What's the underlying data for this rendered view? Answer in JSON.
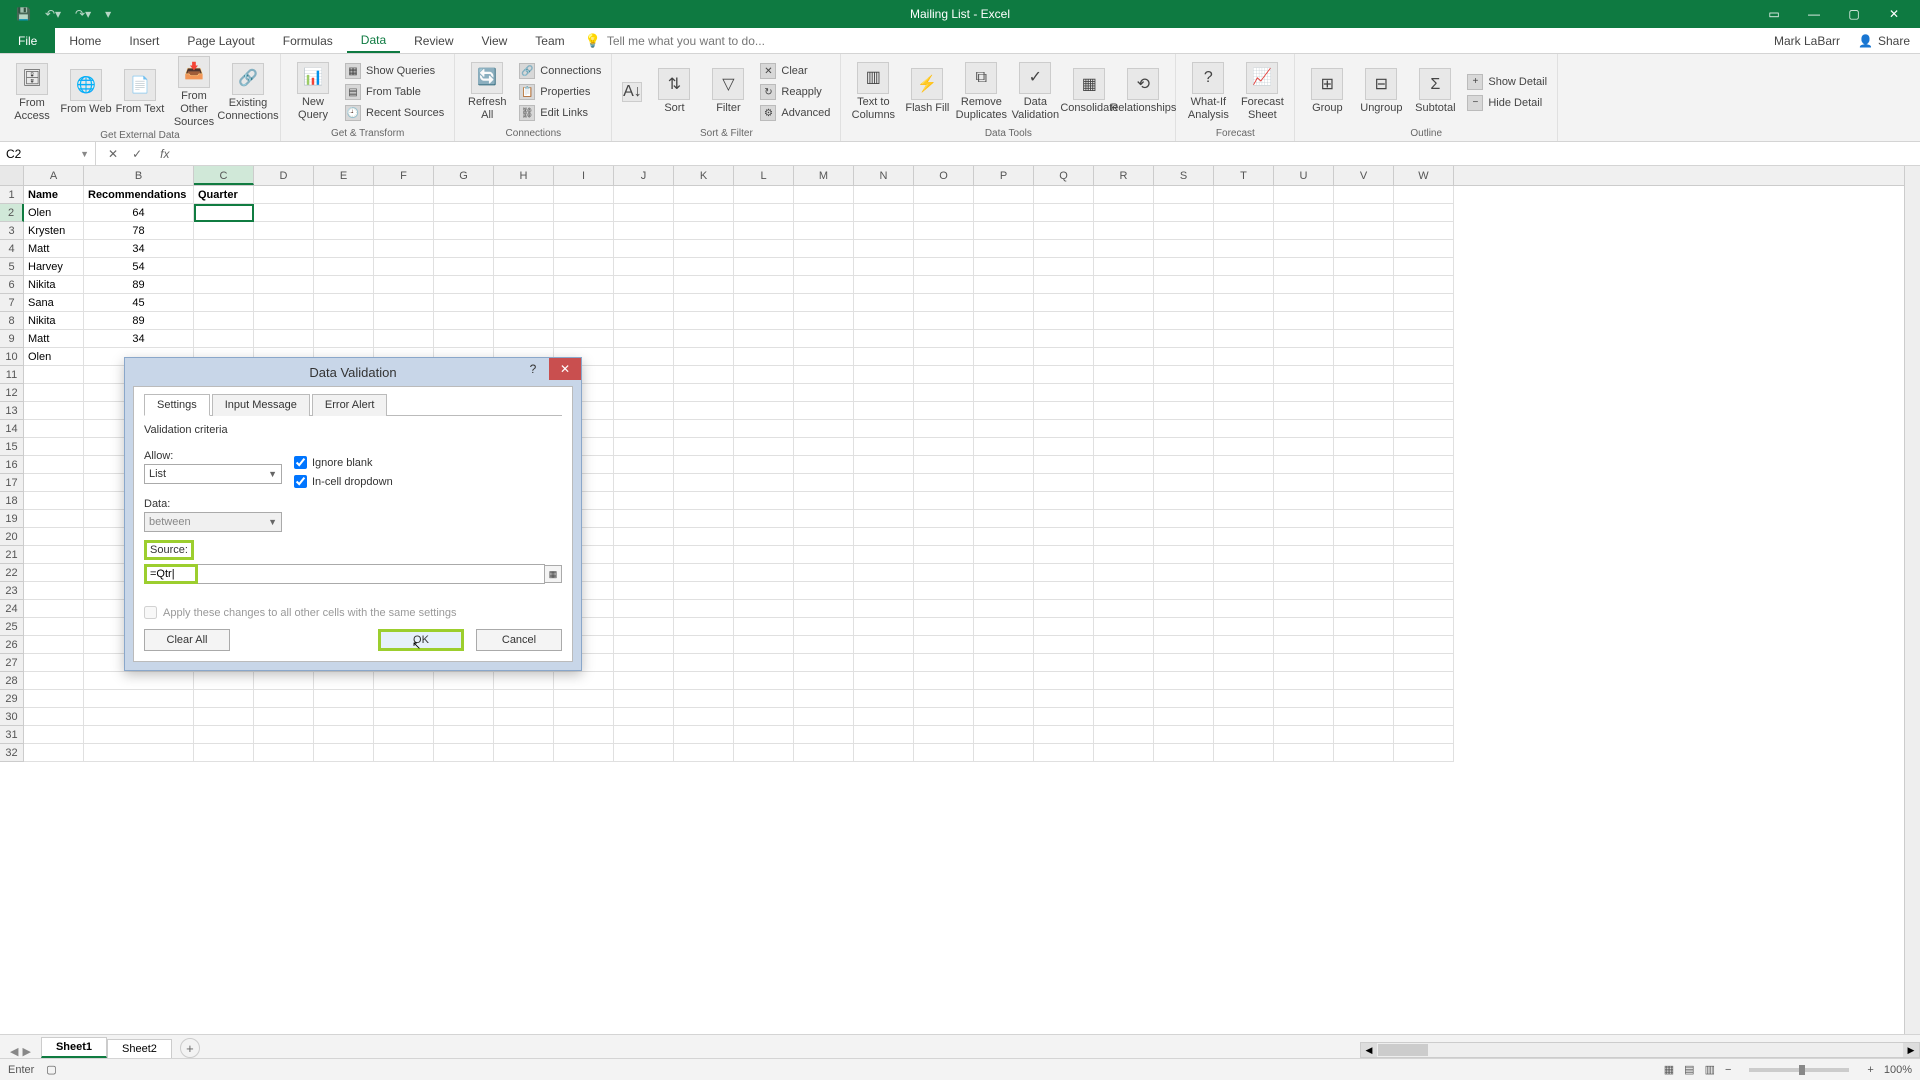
{
  "app": {
    "title": "Mailing List - Excel",
    "user": "Mark LaBarr",
    "share": "Share"
  },
  "tabs": {
    "file": "File",
    "list": [
      "Home",
      "Insert",
      "Page Layout",
      "Formulas",
      "Data",
      "Review",
      "View",
      "Team"
    ],
    "active": "Data",
    "tell_me": "Tell me what you want to do..."
  },
  "ribbon": {
    "groups": {
      "ext_data": {
        "label": "Get External Data",
        "from_access": "From Access",
        "from_web": "From Web",
        "from_text": "From Text",
        "from_other": "From Other Sources",
        "existing": "Existing Connections"
      },
      "get_transform": {
        "label": "Get & Transform",
        "new_query": "New Query",
        "show_queries": "Show Queries",
        "from_table": "From Table",
        "recent": "Recent Sources"
      },
      "connections": {
        "label": "Connections",
        "refresh": "Refresh All",
        "connections": "Connections",
        "properties": "Properties",
        "edit_links": "Edit Links"
      },
      "sort_filter": {
        "label": "Sort & Filter",
        "sort": "Sort",
        "filter": "Filter",
        "clear": "Clear",
        "reapply": "Reapply",
        "advanced": "Advanced"
      },
      "data_tools": {
        "label": "Data Tools",
        "text_cols": "Text to Columns",
        "flash": "Flash Fill",
        "dupes": "Remove Duplicates",
        "validation": "Data Validation",
        "consolidate": "Consolidate",
        "relationships": "Relationships"
      },
      "forecast": {
        "label": "Forecast",
        "whatif": "What-If Analysis",
        "sheet": "Forecast Sheet"
      },
      "outline": {
        "label": "Outline",
        "group": "Group",
        "ungroup": "Ungroup",
        "subtotal": "Subtotal",
        "show_detail": "Show Detail",
        "hide_detail": "Hide Detail"
      }
    }
  },
  "formula_bar": {
    "name_box": "C2",
    "formula": ""
  },
  "columns": [
    "A",
    "B",
    "C",
    "D",
    "E",
    "F",
    "G",
    "H",
    "I",
    "J",
    "K",
    "L",
    "M",
    "N",
    "O",
    "P",
    "Q",
    "R",
    "S",
    "T",
    "U",
    "V",
    "W"
  ],
  "sheet": {
    "headers": [
      "Name",
      "Recommendations",
      "Quarter"
    ],
    "rows": [
      {
        "name": "Olen",
        "rec": "64"
      },
      {
        "name": "Krysten",
        "rec": "78"
      },
      {
        "name": "Matt",
        "rec": "34"
      },
      {
        "name": "Harvey",
        "rec": "54"
      },
      {
        "name": "Nikita",
        "rec": "89"
      },
      {
        "name": "Sana",
        "rec": "45"
      },
      {
        "name": "Nikita",
        "rec": "89"
      },
      {
        "name": "Matt",
        "rec": "34"
      },
      {
        "name": "Olen",
        "rec": ""
      }
    ],
    "active_cell": "C2"
  },
  "dialog": {
    "title": "Data Validation",
    "tabs": [
      "Settings",
      "Input Message",
      "Error Alert"
    ],
    "active_tab": "Settings",
    "criteria_label": "Validation criteria",
    "allow_label": "Allow:",
    "allow_value": "List",
    "data_label": "Data:",
    "data_value": "between",
    "ignore_blank": "Ignore blank",
    "incell_dropdown": "In-cell dropdown",
    "source_label": "Source:",
    "source_value": "=Qtr|",
    "apply_label": "Apply these changes to all other cells with the same settings",
    "clear_all": "Clear All",
    "ok": "OK",
    "cancel": "Cancel"
  },
  "sheets": {
    "list": [
      "Sheet1",
      "Sheet2"
    ],
    "active": "Sheet1"
  },
  "status": {
    "mode": "Enter",
    "zoom": "100%"
  }
}
